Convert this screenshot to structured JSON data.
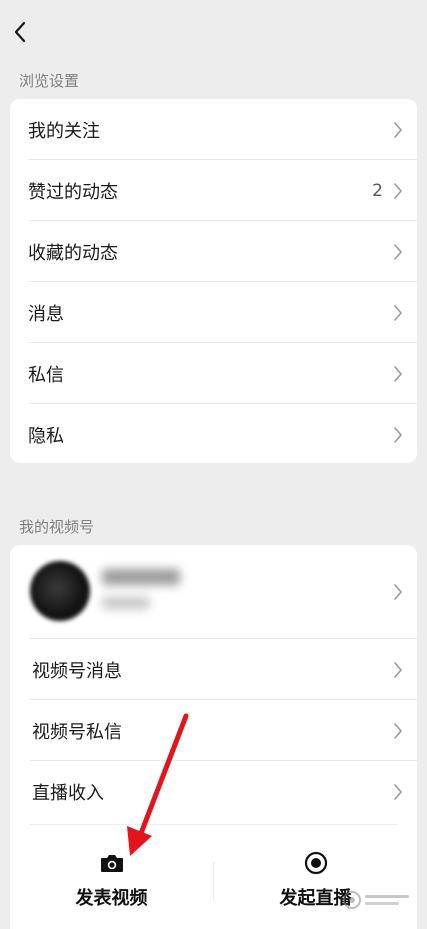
{
  "browse_settings": {
    "title": "浏览设置",
    "items": [
      {
        "label": "我的关注",
        "count": ""
      },
      {
        "label": "赞过的动态",
        "count": "2"
      },
      {
        "label": "收藏的动态",
        "count": ""
      },
      {
        "label": "消息",
        "count": ""
      },
      {
        "label": "私信",
        "count": ""
      },
      {
        "label": "隐私",
        "count": ""
      }
    ]
  },
  "my_channel": {
    "title": "我的视频号",
    "items": [
      {
        "label": "视频号消息"
      },
      {
        "label": "视频号私信"
      },
      {
        "label": "直播收入"
      }
    ]
  },
  "actions": {
    "post_video": "发表视频",
    "start_live": "发起直播"
  },
  "colors": {
    "background": "#ededed",
    "card": "#ffffff",
    "arrow": "#e3141b"
  }
}
